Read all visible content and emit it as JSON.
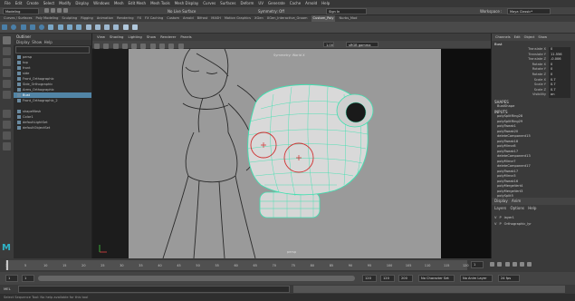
{
  "menubar": {
    "items": [
      "File",
      "Edit",
      "Create",
      "Select",
      "Modify",
      "Display",
      "Windows",
      "Mesh",
      "Edit Mesh",
      "Mesh Tools",
      "Mesh Display",
      "Curves",
      "Surfaces",
      "Deform",
      "UV",
      "Generate",
      "Cache",
      "Arnold",
      "Help"
    ],
    "workspace_label": "Workspace :",
    "workspace_value": "Maya Classic*"
  },
  "status": {
    "mode": "Modeling",
    "no_live": "No Live Surface",
    "symmetry": "Symmetry: Off",
    "sign_in": "Sign In"
  },
  "shelf": {
    "tabs": [
      "Curves / Surfaces",
      "Poly Modeling",
      "Sculpting",
      "Rigging",
      "Animation",
      "Rendering",
      "FX",
      "FX Caching",
      "Custom",
      "Arnold",
      "Bifrost",
      "MASH",
      "Motion Graphics",
      "XGen",
      "XGen_Interactive_Groom",
      "Custom_Poly",
      "Nurbs_Mod"
    ],
    "active": "Custom_Poly"
  },
  "outliner": {
    "title": "Outliner",
    "menus": [
      "Display",
      "Show",
      "Help"
    ],
    "rows": [
      "persp",
      "top",
      "front",
      "side",
      "Front_Orthographic",
      "Side_Orthographic",
      "Arms_Orthographic",
      "Bust",
      "Front_Orthographic_2",
      "",
      "shapeMesh",
      "Color1",
      "defaultLightSet",
      "defaultObjectSet"
    ],
    "selected_index": 7
  },
  "viewport": {
    "menus": [
      "View",
      "Shading",
      "Lighting",
      "Show",
      "Renderer",
      "Panels"
    ],
    "label_camera": "persp",
    "label_tool": "Symmetry: World X",
    "rtx": "sRGB gamma"
  },
  "channelbox": {
    "tabs": [
      "Channels",
      "Edit",
      "Object",
      "Show"
    ],
    "object": "Bust",
    "channels": [
      {
        "label": "Translate X",
        "value": "0"
      },
      {
        "label": "Translate Y",
        "value": "11.556"
      },
      {
        "label": "Translate Z",
        "value": "-0.006"
      },
      {
        "label": "Rotate X",
        "value": "0"
      },
      {
        "label": "Rotate Y",
        "value": "0"
      },
      {
        "label": "Rotate Z",
        "value": "0"
      },
      {
        "label": "Scale X",
        "value": "0.7"
      },
      {
        "label": "Scale Y",
        "value": "0.7"
      },
      {
        "label": "Scale Z",
        "value": "0.7"
      },
      {
        "label": "Visibility",
        "value": "on"
      }
    ],
    "shapes_header": "SHAPES",
    "shape": "BustShape",
    "inputs_header": "INPUTS",
    "inputs": [
      "polySplitRing28",
      "polySplitRing29",
      "polyTweak1",
      "polyTweak20",
      "deleteComponent15",
      "polyTweak18",
      "polyMirror8",
      "polyTweak17",
      "deleteComponent13",
      "polyMirror7",
      "deleteComponent17",
      "polyTweak17",
      "polyMirror3",
      "polyTweak16",
      "polyMergeVert4",
      "polyMergeVert3",
      "polySplit5"
    ],
    "display_tabs": [
      "Display",
      "Anim"
    ],
    "layer_menus": [
      "Layers",
      "Options",
      "Help"
    ],
    "layers": [
      {
        "v": "V",
        "p": "P",
        "name": "layer1"
      },
      {
        "v": "V",
        "p": "P",
        "name": "Orthographic_lyr"
      }
    ]
  },
  "timeslider": {
    "ticks": [
      "1",
      "5",
      "10",
      "15",
      "20",
      "25",
      "30",
      "35",
      "40",
      "45",
      "50",
      "55",
      "60",
      "65",
      "70",
      "75",
      "80",
      "85",
      "90",
      "95",
      "100",
      "105",
      "110",
      "115",
      "120"
    ],
    "current": "1"
  },
  "range": {
    "start": "1",
    "start2": "1",
    "end": "120",
    "end2": "120",
    "end3": "200",
    "char_set": "No Character Set",
    "anim_layer": "No Anim Layer",
    "fps": "24 fps"
  },
  "cmd": {
    "lang": "MEL"
  },
  "help": {
    "text": "Select Sequence Tool: No help available for this tool"
  }
}
